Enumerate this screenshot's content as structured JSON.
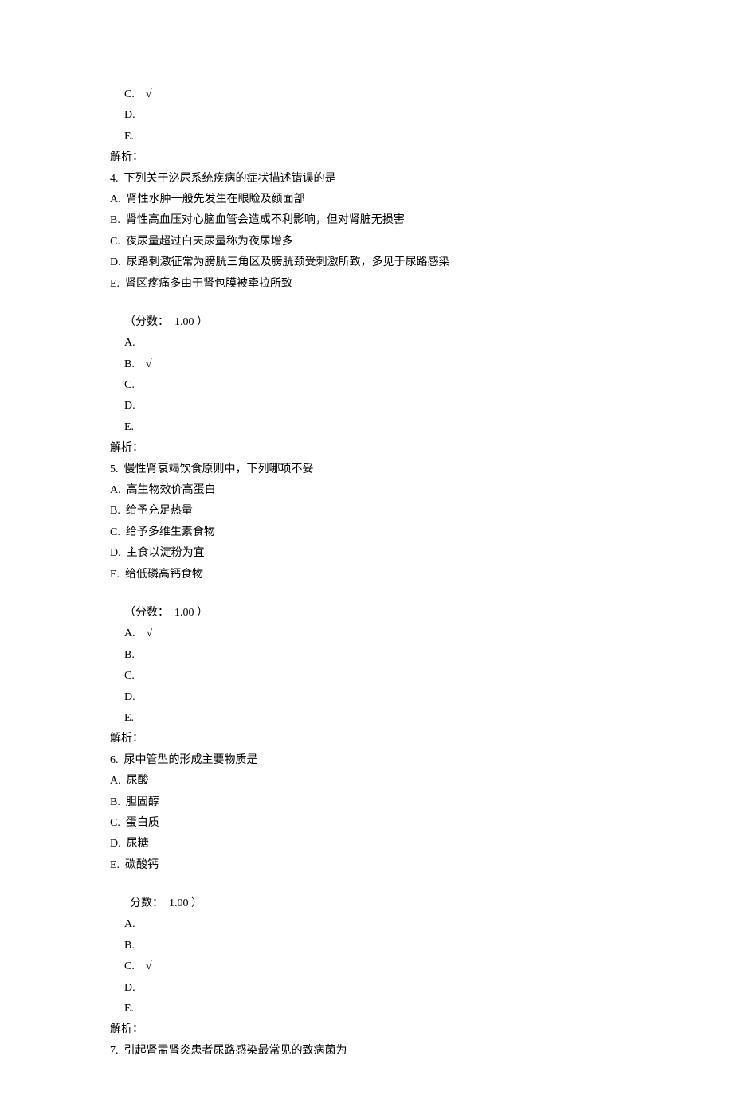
{
  "q3_answers": {
    "c": "C.    √",
    "d": "D.",
    "e": "E."
  },
  "analysis_label": "解析：",
  "q4": {
    "num_text": "4.  下列关于泌尿系统疾病的症状描述错误的是",
    "opts": {
      "a": "A.  肾性水肿一般先发生在眼睑及颜面部",
      "b": "B.  肾性高血压对心脑血管会造成不利影响，但对肾脏无损害",
      "c": "C.  夜尿量超过白天尿量称为夜尿增多",
      "d": "D.  尿路刺激征常为膀胱三角区及膀胱颈受刺激所致，多见于尿路感染",
      "e": "E.  肾区疼痛多由于肾包膜被牵拉所致"
    },
    "score": "（分数：  1.00 ）",
    "ans": {
      "a": "A.",
      "b": "B.    √",
      "c": "C.",
      "d": "D.",
      "e": "E."
    }
  },
  "q5": {
    "num_text": "5.  慢性肾衰竭饮食原则中，下列哪项不妥",
    "opts": {
      "a": "A.  高生物效价高蛋白",
      "b": "B.  给予充足热量",
      "c": "C.  给予多维生素食物",
      "d": "D.  主食以淀粉为宜",
      "e": "E.  给低磷高钙食物"
    },
    "score": "（分数：  1.00 ）",
    "ans": {
      "a": "A.    √",
      "b": "B.",
      "c": "C.",
      "d": "D.",
      "e": "E."
    }
  },
  "q6": {
    "num_text": "6.  尿中管型的形成主要物质是",
    "opts": {
      "a": "A.  尿酸",
      "b": "B.  胆固醇",
      "c": "C.  蛋白质",
      "d": "D.  尿糖",
      "e": "E.  碳酸钙"
    },
    "score": "  分数：  1.00 ）",
    "ans": {
      "a": "A.",
      "b": "B.",
      "c": "C.    √",
      "d": "D.",
      "e": "E."
    }
  },
  "q7": {
    "num_text": "7.  引起肾盂肾炎患者尿路感染最常见的致病菌为"
  }
}
